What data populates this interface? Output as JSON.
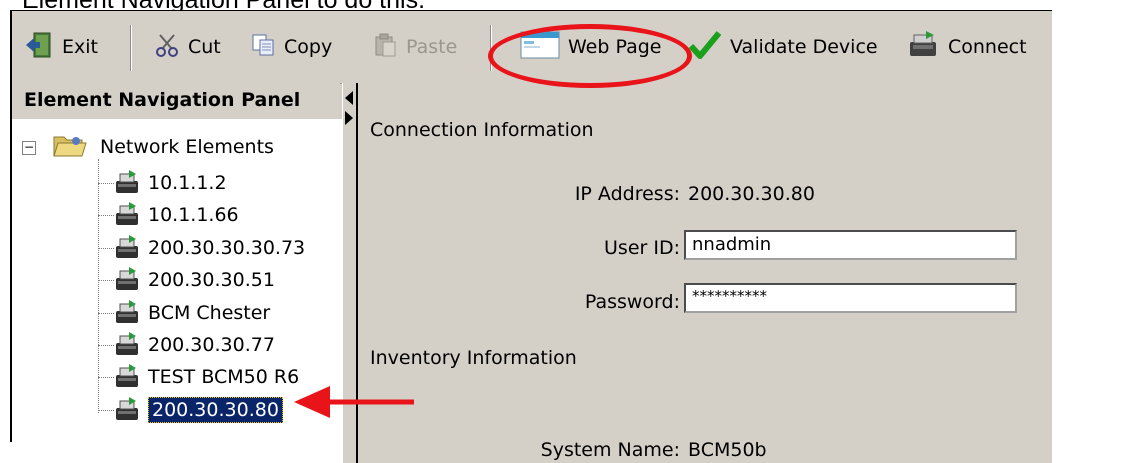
{
  "caption": "Element Navigation Panel to do this.",
  "toolbar": {
    "exit_label": "Exit",
    "cut_label": "Cut",
    "copy_label": "Copy",
    "paste_label": "Paste",
    "webpage_label": "Web Page",
    "validate_label": "Validate Device",
    "connect_label": "Connect",
    "paste_disabled": true
  },
  "panel": {
    "title": "Element Navigation Panel",
    "root_label": "Network Elements",
    "items": [
      {
        "label": "10.1.1.2"
      },
      {
        "label": "10.1.1.66"
      },
      {
        "label": "200.30.30.30.73"
      },
      {
        "label": "200.30.30.51"
      },
      {
        "label": "BCM Chester"
      },
      {
        "label": "200.30.30.77"
      },
      {
        "label": "TEST BCM50 R6"
      },
      {
        "label": "200.30.30.80",
        "selected": true
      }
    ]
  },
  "main": {
    "connection_heading": "Connection Information",
    "ip_label": "IP Address:",
    "ip_value": "200.30.30.80",
    "userid_label": "User ID:",
    "userid_value": "nnadmin",
    "password_label": "Password:",
    "password_value": "**********",
    "inventory_heading": "Inventory Information",
    "sysname_label": "System Name:",
    "sysname_value": "BCM50b"
  },
  "colors": {
    "highlight_ring": "#e8141a",
    "selection_bg": "#0a246a",
    "validate_check": "#1aa01a"
  },
  "icons": {
    "exit": "exit-door-icon",
    "cut": "scissors-icon",
    "copy": "copy-icon",
    "paste": "clipboard-icon",
    "webpage": "web-page-icon",
    "validate": "checkmark-icon",
    "connect": "device-connect-icon",
    "root": "folder-icon",
    "device": "network-device-icon"
  }
}
